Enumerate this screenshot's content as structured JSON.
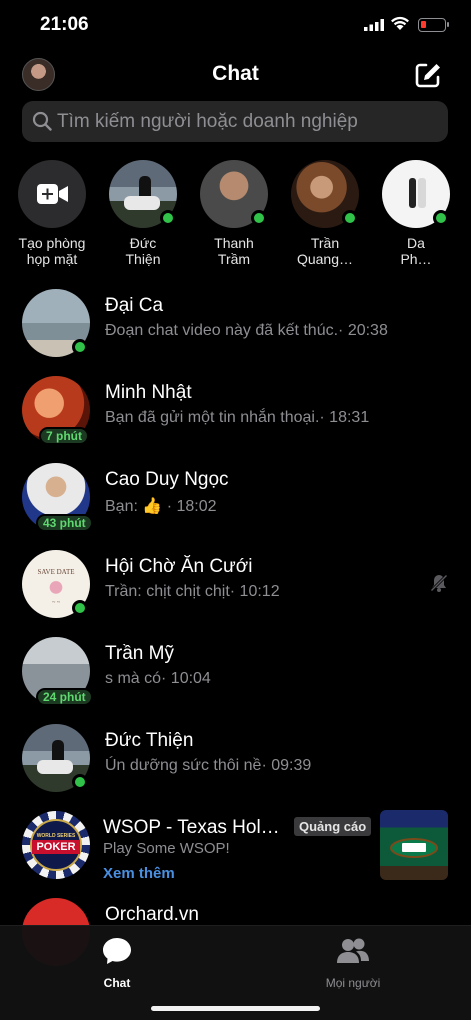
{
  "status_bar": {
    "time": "21:06"
  },
  "header": {
    "title": "Chat"
  },
  "search": {
    "placeholder": "Tìm kiếm người hoặc doanh nghiệp"
  },
  "stories": [
    {
      "line1": "Tạo phòng",
      "line2": "họp mặt",
      "icon": "video-camera-plus-icon"
    },
    {
      "line1": "Đức",
      "line2": "Thiện",
      "online": true
    },
    {
      "line1": "Thanh",
      "line2": "Trầm",
      "online": true
    },
    {
      "line1": "Trần",
      "line2": "Quang…",
      "online": true
    },
    {
      "line1": "Da",
      "line2": "Ph…",
      "online": true
    }
  ],
  "chats": [
    {
      "name": "Đại Ca",
      "preview": "Đoạn chat video này đã kết thúc.· 20:38",
      "online": true
    },
    {
      "name": "Minh Nhật",
      "preview": "Bạn đã gửi một tin nhắn thoại.· 18:31",
      "badge": "7 phút"
    },
    {
      "name": "Cao Duy Ngọc",
      "preview_prefix": "Bạn: ",
      "preview_emoji": "👍",
      "preview_time": " · 18:02",
      "badge": "43 phút"
    },
    {
      "name": "Hội Chờ Ăn Cưới",
      "preview": "Trần: chịt chịt chịt· 10:12",
      "online": true,
      "muted": true
    },
    {
      "name": "Trần Mỹ",
      "preview": "s mà có· 10:04",
      "badge": "24 phút"
    },
    {
      "name": "Đức Thiện",
      "preview": "Ún dưỡng sức thôi nề· 09:39",
      "online": true
    }
  ],
  "ad": {
    "name": "WSOP - Texas Hol…",
    "label": "Quảng cáo",
    "preview": "Play Some WSOP!",
    "cta": "Xem thêm",
    "logo_top": "WORLD SERIES",
    "logo_main": "POKER"
  },
  "partial_chat": {
    "name": "Orchard.vn"
  },
  "tabs": [
    {
      "label": "Chat",
      "active": true
    },
    {
      "label": "Mọi người",
      "active": false
    }
  ],
  "colors": {
    "online": "#31c24a",
    "link": "#4a90e2",
    "background": "#000000"
  }
}
